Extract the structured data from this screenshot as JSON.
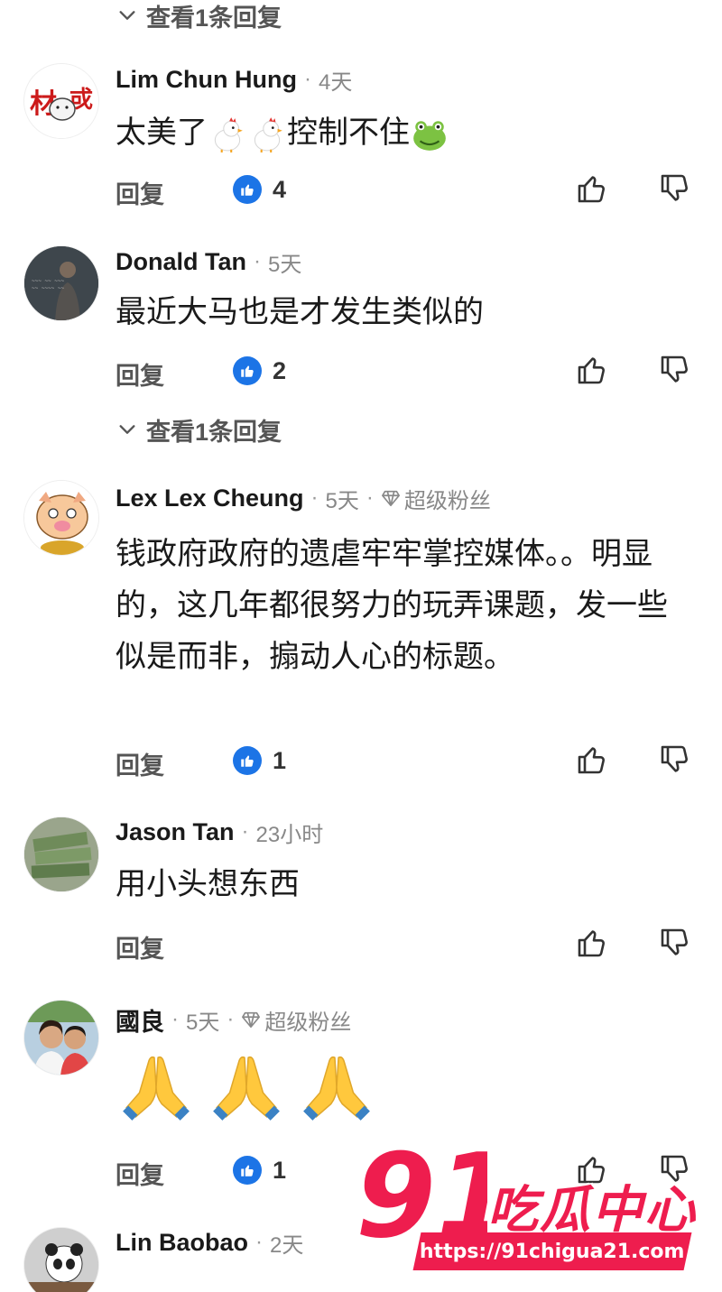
{
  "colors": {
    "accent_blue": "#1c74e6",
    "watermark_red": "#ee1d4e",
    "secondary_text": "#888888"
  },
  "top_view_replies": {
    "label": "查看1条回复"
  },
  "comments": [
    {
      "name": "Lim Chun Hung",
      "time": "4天",
      "text": "太美了",
      "text_after_emojis": "控制不住",
      "reply_label": "回复",
      "likes": "4",
      "avatar_text": "材 戓",
      "inline_emojis": [
        "chicken-emoji",
        "chicken-emoji",
        "frog-emoji"
      ]
    },
    {
      "name": "Donald Tan",
      "time": "5天",
      "text": "最近大马也是才发生类似的",
      "reply_label": "回复",
      "likes": "2",
      "view_replies": "查看1条回复"
    },
    {
      "name": "Lex Lex Cheung",
      "time": "5天",
      "badge": "超级粉丝",
      "text": "钱政府政府的遗虐牢牢掌控媒体。。明显的，这几年都很努力的玩弄课题，发一些似是而非，搧动人心的标题。",
      "reply_label": "回复",
      "likes": "1"
    },
    {
      "name": "Jason Tan",
      "time": "23小时",
      "text": "用小头想东西",
      "reply_label": "回复"
    },
    {
      "name": "國良",
      "time": "5天",
      "badge": "超级粉丝",
      "emojis": [
        "folded-hands-emoji",
        "folded-hands-emoji",
        "folded-hands-emoji"
      ],
      "reply_label": "回复",
      "likes": "1"
    },
    {
      "name": "Lin Baobao",
      "time": "2天"
    }
  ],
  "watermark": {
    "number": "91",
    "brand": "吃瓜中心",
    "url": "https://91chigua21.com"
  }
}
